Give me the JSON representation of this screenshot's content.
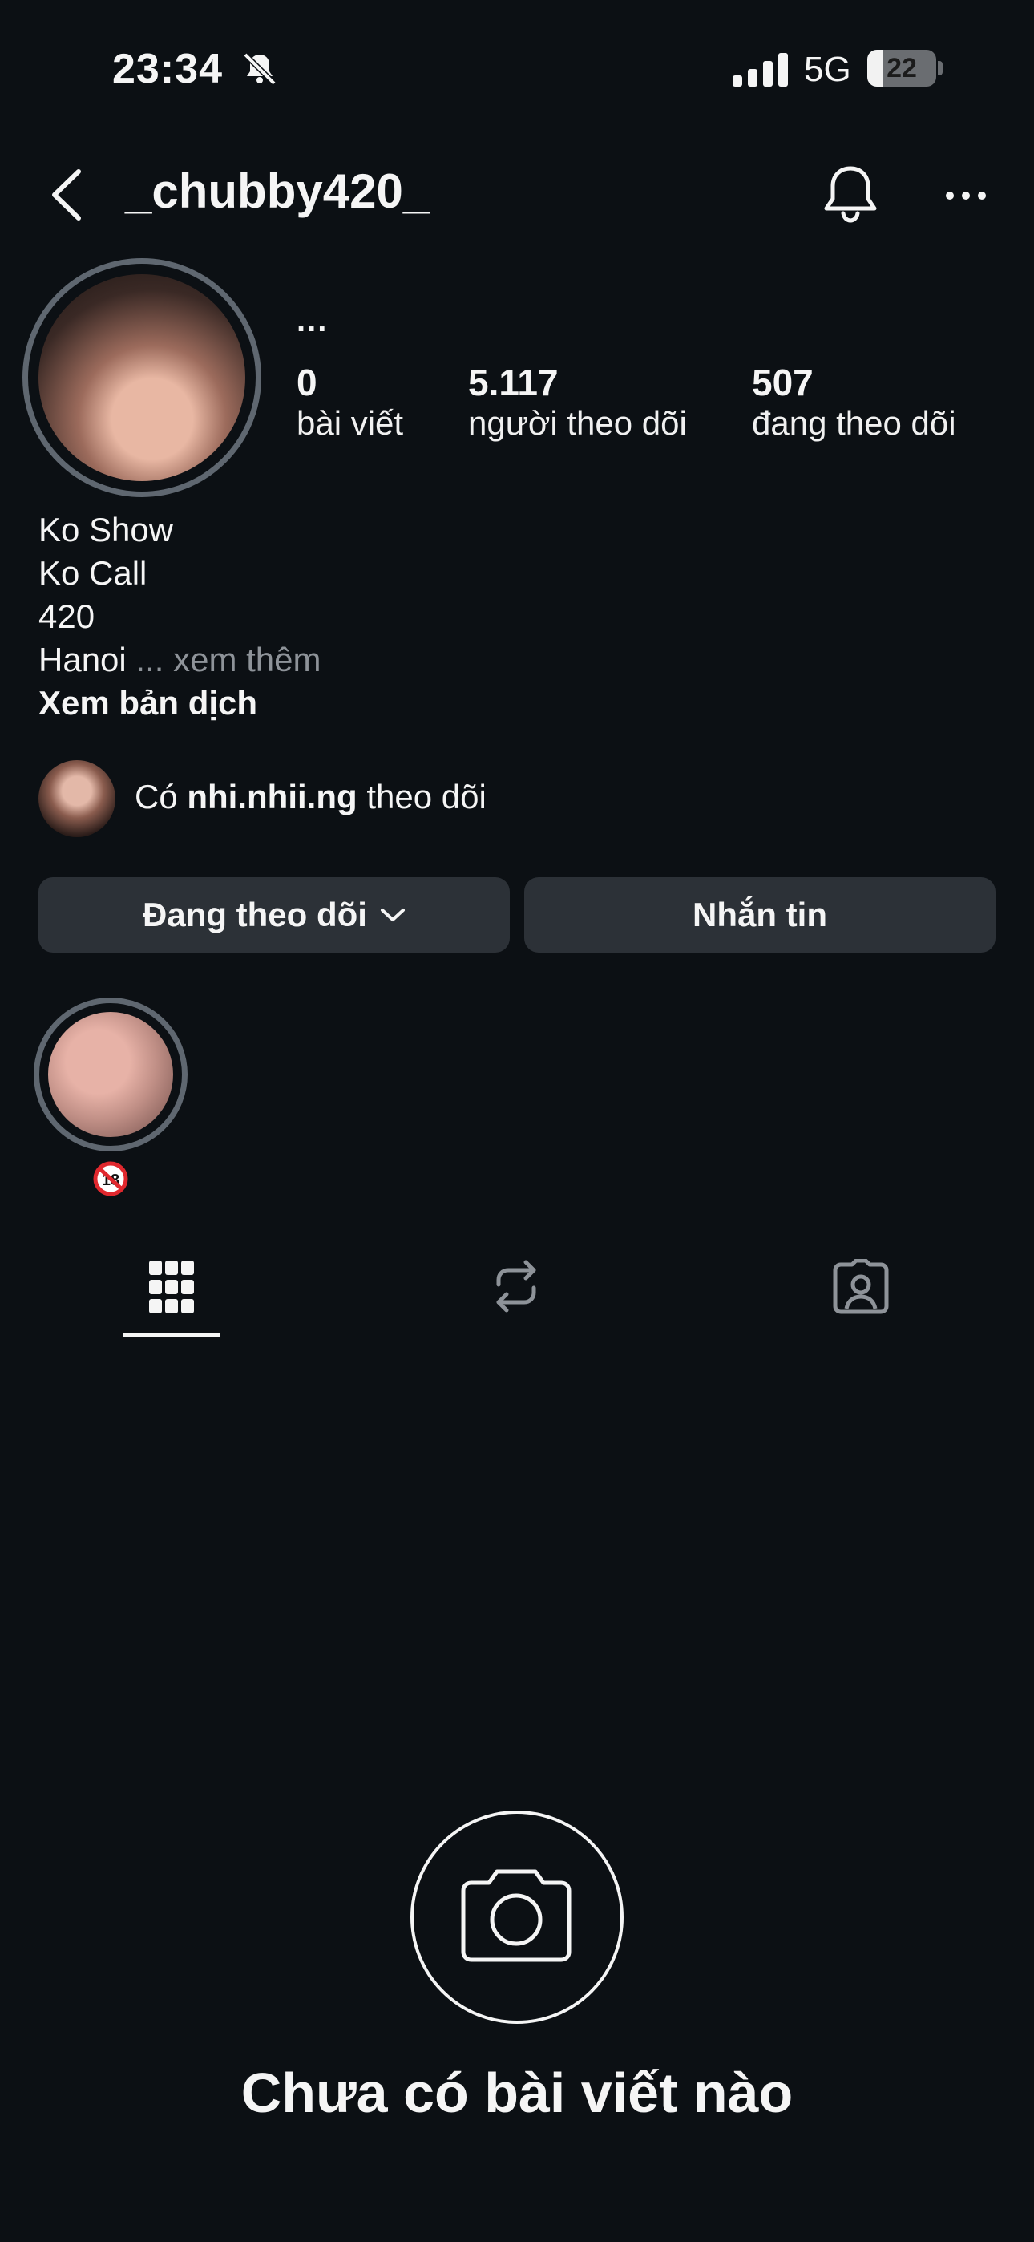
{
  "status_bar": {
    "time": "23:34",
    "network": "5G",
    "battery": "22",
    "battery_level": 0.22
  },
  "header": {
    "username": "_chubby420_"
  },
  "profile": {
    "name_placeholder": "...",
    "stats": [
      {
        "value": "0",
        "label": "bài viết"
      },
      {
        "value": "5.117",
        "label": "người theo dõi"
      },
      {
        "value": "507",
        "label": "đang theo dõi"
      }
    ],
    "bio_lines": [
      "Ko Show",
      "Ko Call",
      "420"
    ],
    "bio_last": "Hanoi",
    "bio_ellipsis": "...",
    "see_more": "xem thêm",
    "translate": "Xem bản dịch"
  },
  "followed_by": {
    "prefix": "Có",
    "name": "nhi.nhii.ng",
    "suffix": "theo dõi"
  },
  "buttons": {
    "following": "Đang theo dõi",
    "message": "Nhắn tin"
  },
  "highlight": {
    "label_icon": "no-under-18-emoji"
  },
  "tabs": [
    {
      "name": "grid-icon",
      "active": true
    },
    {
      "name": "reposts-icon",
      "active": false
    },
    {
      "name": "tagged-icon",
      "active": false
    }
  ],
  "empty_state": {
    "title": "Chưa có bài viết nào"
  },
  "colors": {
    "background": "#0c1014",
    "button": "#2c3137",
    "ring": "#5f6770",
    "text": "#f5f5f5",
    "muted": "#8e9399"
  }
}
